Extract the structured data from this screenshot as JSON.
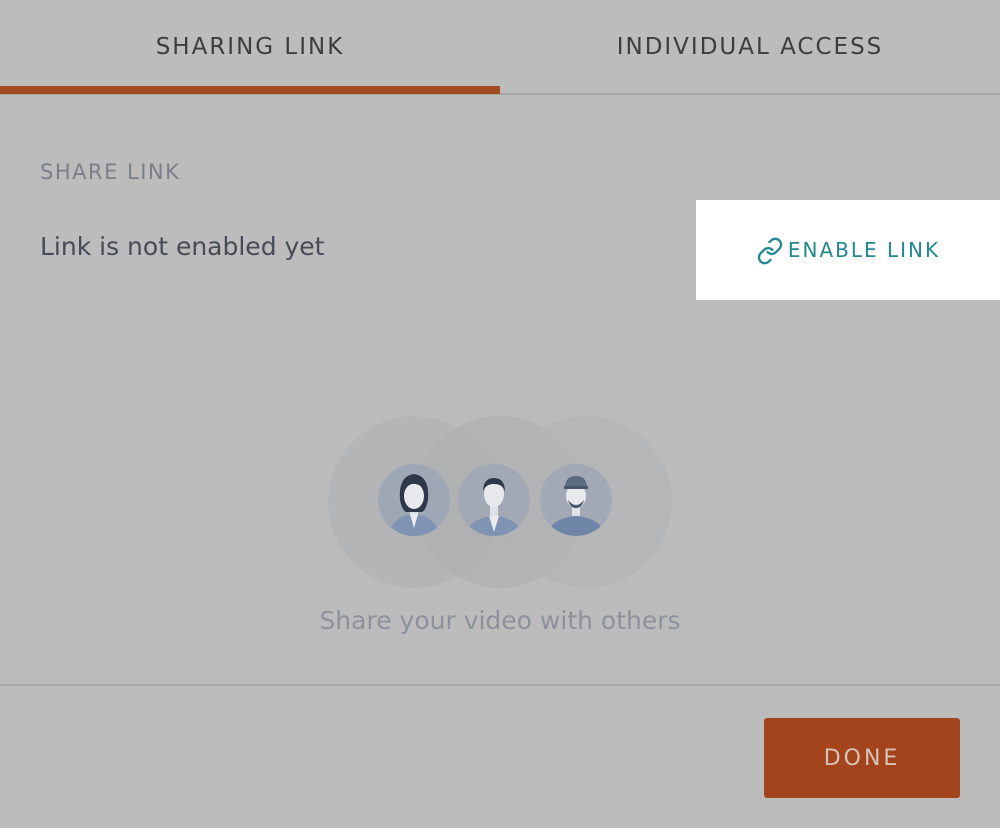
{
  "tabs": [
    {
      "label": "SHARING LINK",
      "active": true
    },
    {
      "label": "INDIVIDUAL ACCESS",
      "active": false
    }
  ],
  "share_link": {
    "section_label": "SHARE LINK",
    "status": "Link is not enabled yet",
    "enable_label": "ENABLE LINK"
  },
  "empty_state": {
    "caption": "Share your video with others"
  },
  "footer": {
    "done_label": "DONE"
  },
  "colors": {
    "accent": "#a34a21",
    "link": "#22878f",
    "overlay_bg": "#bcbcbc"
  },
  "icons": {
    "enable": "link-icon",
    "avatars": [
      "woman-avatar-icon",
      "man-avatar-icon",
      "worker-avatar-icon"
    ]
  }
}
